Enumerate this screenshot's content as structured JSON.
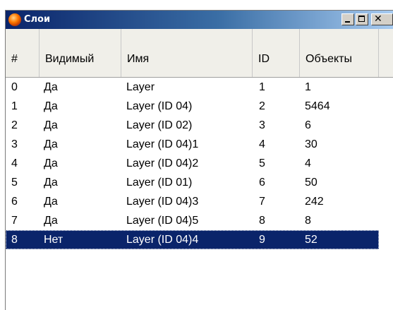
{
  "window": {
    "title": "Слои",
    "controls": {
      "minimize": "minimize",
      "maximize": "maximize",
      "close": "close"
    }
  },
  "table": {
    "columns": [
      "#",
      "Видимый",
      "Имя",
      "ID",
      "Объекты"
    ],
    "rows": [
      [
        "0",
        "Да",
        "Layer",
        "1",
        "1"
      ],
      [
        "1",
        "Да",
        "Layer (ID 04)",
        "2",
        "5464"
      ],
      [
        "2",
        "Да",
        "Layer (ID 02)",
        "3",
        "6"
      ],
      [
        "3",
        "Да",
        "Layer (ID 04)1",
        "4",
        "30"
      ],
      [
        "4",
        "Да",
        "Layer (ID 04)2",
        "5",
        "4"
      ],
      [
        "5",
        "Да",
        "Layer (ID 01)",
        "6",
        "50"
      ],
      [
        "6",
        "Да",
        "Layer (ID 04)3",
        "7",
        "242"
      ],
      [
        "7",
        "Да",
        "Layer (ID 04)5",
        "8",
        "8"
      ],
      [
        "8",
        "Нет",
        "Layer (ID 04)4",
        "9",
        "52"
      ]
    ],
    "selected_row": 8
  },
  "colors": {
    "selection": "#0a246a",
    "titlebar_start": "#0a246a",
    "titlebar_end": "#a6caf0",
    "header_bg": "#f0efe9"
  }
}
